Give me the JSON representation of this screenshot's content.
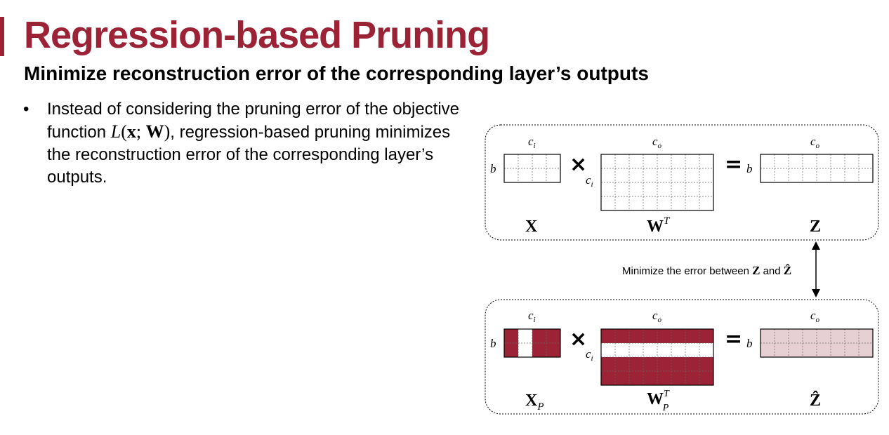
{
  "slide": {
    "title": "Regression-based Pruning",
    "subtitle": "Minimize reconstruction error of the corresponding layer’s outputs",
    "bullet": {
      "before_math": "Instead of considering the pruning error of the objective function ",
      "math_fn": "L",
      "math_open": "(",
      "math_x": "x",
      "math_sep": "; ",
      "math_w": "W",
      "math_close": ")",
      "after_math": ", regression-based pruning minimizes the reconstruction error of the corresponding layer’s outputs."
    }
  },
  "diagram": {
    "colors": {
      "accent": "#9b2335",
      "light_accent": "#e6d0d3",
      "border": "#000000"
    },
    "top": {
      "x_label": "X",
      "w_label": "W",
      "w_sup": "T",
      "z_label": "Z",
      "dim_ci": "c",
      "dim_ci_sub": "i",
      "dim_co": "c",
      "dim_co_sub": "o",
      "dim_b": "b",
      "times": "×",
      "equals": "="
    },
    "middle": {
      "text": "Minimize the error between ",
      "z": "Z",
      "and": " and ",
      "zhat": "Ẑ"
    },
    "bottom": {
      "x_label": "X",
      "x_sub": "P",
      "w_label": "W",
      "w_sup": "T",
      "w_sub": "P",
      "z_label": "Ẑ",
      "dim_ci": "c",
      "dim_ci_sub": "i",
      "dim_co": "c",
      "dim_co_sub": "o",
      "dim_b": "b",
      "times": "×",
      "equals": "="
    }
  }
}
